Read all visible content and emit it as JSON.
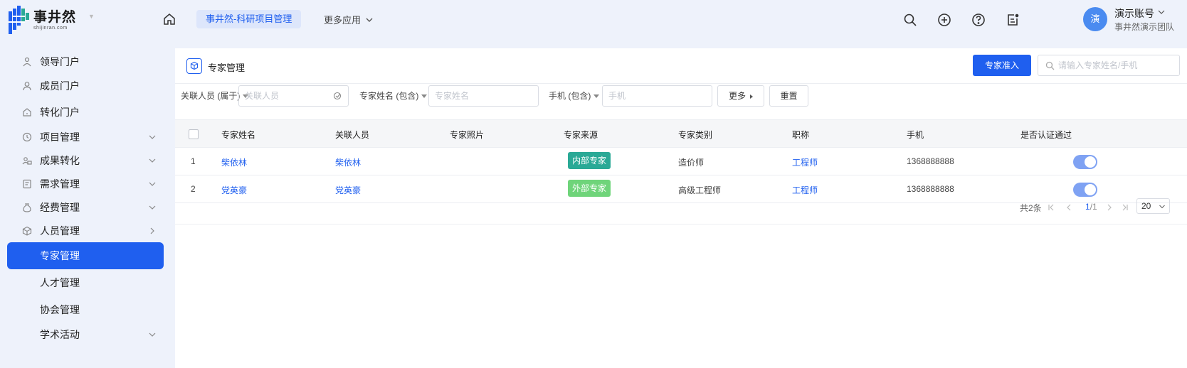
{
  "header": {
    "logo_cn": "事井然",
    "logo_en": "shijinran.com",
    "active_app": "事井然-科研项目管理",
    "more_apps": "更多应用",
    "account_name": "演示账号",
    "account_team": "事井然演示团队",
    "avatar_text": "演",
    "icons": [
      "home-icon",
      "search-icon",
      "plus-circle-icon",
      "help-icon",
      "notification-icon"
    ]
  },
  "sidebar": {
    "items": [
      {
        "label": "领导门户",
        "icon": "leader-icon",
        "chevron": ""
      },
      {
        "label": "成员门户",
        "icon": "member-icon",
        "chevron": ""
      },
      {
        "label": "转化门户",
        "icon": "home-outline-icon",
        "chevron": ""
      },
      {
        "label": "项目管理",
        "icon": "clock-icon",
        "chevron": "down"
      },
      {
        "label": "成果转化",
        "icon": "users-icon",
        "chevron": "down"
      },
      {
        "label": "需求管理",
        "icon": "document-icon",
        "chevron": "down"
      },
      {
        "label": "经费管理",
        "icon": "money-bag-icon",
        "chevron": "down"
      },
      {
        "label": "人员管理",
        "icon": "cube-icon",
        "chevron": "right"
      },
      {
        "label": "专家管理",
        "icon": "",
        "chevron": "",
        "active": true
      },
      {
        "label": "人才管理",
        "icon": "",
        "chevron": ""
      },
      {
        "label": "协会管理",
        "icon": "",
        "chevron": ""
      },
      {
        "label": "学术活动",
        "icon": "",
        "chevron": "down"
      }
    ]
  },
  "main": {
    "title": "专家管理",
    "primary_button": "专家准入",
    "search_placeholder": "请输入专家姓名/手机",
    "filters": {
      "related_label": "关联人员 (属于)",
      "related_placeholder": "关联人员",
      "name_label": "专家姓名 (包含)",
      "name_placeholder": "专家姓名",
      "phone_label": "手机 (包含)",
      "phone_placeholder": "手机",
      "more_button": "更多",
      "reset_button": "重置"
    },
    "table": {
      "headers": [
        "专家姓名",
        "关联人员",
        "专家照片",
        "专家来源",
        "专家类别",
        "职称",
        "手机",
        "是否认证通过"
      ],
      "rows": [
        {
          "index": "1",
          "name": "柴依林",
          "related": "柴依林",
          "source": "内部专家",
          "source_color": "#2aa996",
          "category": "造价师",
          "title": "工程师",
          "phone": "1368888888",
          "certified": true
        },
        {
          "index": "2",
          "name": "党英豪",
          "related": "党英豪",
          "source": "外部专家",
          "source_color": "#6fd47a",
          "category": "高级工程师",
          "title": "工程师",
          "phone": "1368888888",
          "certified": true
        }
      ]
    },
    "pagination": {
      "total": "共2条",
      "current": "1",
      "pages": "/1",
      "page_size": "20"
    }
  },
  "colors": {
    "primary": "#1f5fef",
    "background": "#eef2fb",
    "toggle_on": "#7fa2f3"
  }
}
